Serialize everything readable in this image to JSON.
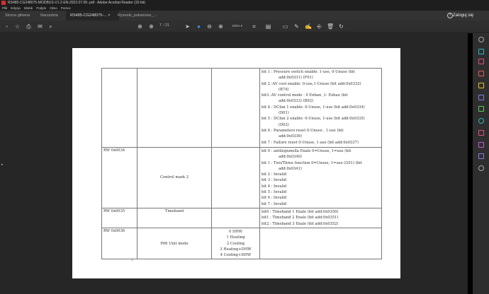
{
  "window": {
    "title": "RS485-CG248075-MODBUS-V1.2-EN-2022.07.05-.pdf - Adobe Acrobat Reader (32-bit)"
  },
  "menu": [
    "Plik",
    "Edycja",
    "Widok",
    "Podpis",
    "Okno",
    "Pomoc"
  ],
  "tabs": [
    "Strona główna",
    "Narzędzia",
    "RS485-CG248075-...",
    "Rysunki_pokazowe_..."
  ],
  "login": "Zaloguj się",
  "toolbar": {
    "page_current": "7",
    "page_total": "/ 21",
    "zoom": "100%"
  },
  "table": {
    "rows": [
      {
        "addr": "",
        "name": "",
        "values": [],
        "bits": [
          [
            "bit 1 : Pressure switch enable: 1-use, 0-Unuse (bit",
            "add:0x0331)  (F01)"
          ],
          [
            "bit 2 :AV cool enable: 0-use,1-Unuse (bit add:0x0332)",
            "(B74)"
          ],
          [
            "bit3  :AV  control  mode :  0  Enhan  ,1-  Exhau  (bit",
            "add:0x0333)  (B92)"
          ],
          [
            "bit 4 : DCfan 1 enable: 0-Unuse, 1-use (bit add:0x0334)",
            "(D01)"
          ],
          [
            "bit 5 : DCfan 2 enable: 0-Unuse, 1-use (bit add:0x0335)",
            "(D02)"
          ],
          [
            "bit  6  :  Parameters  reset  0-Unuse ,  1-use  (bit",
            "add:0x0336)"
          ],
          [
            "bit 7 : Failure reset 0-Unuse, 1-use (bit add:0x0337)"
          ]
        ]
      },
      {
        "addr": "RW 0x0034",
        "name": "Control mark 2",
        "values": [],
        "bits": [
          [
            "bit 0 : antilegionella Enale 0=Unuse, 1=use  (bit",
            "add:0x0340)"
          ],
          [
            "bit 1 : Two/Three function 0=Unuse, 1=use (G01) (bit",
            "add:0x0341)"
          ],
          [
            "bit 2 : Invalid"
          ],
          [
            "bit 3 : Invalid"
          ],
          [
            "bit 4 : Invalid"
          ],
          [
            "bit 5 : Invalid"
          ],
          [
            "bit 6 : Invalid"
          ],
          [
            "bit 7 : Invalid"
          ]
        ]
      },
      {
        "addr": "RW 0x0035",
        "name": "Timeband",
        "values": [],
        "bits": [
          [
            "bit0 : Timeband 1 Enale (bit add:0x0350)"
          ],
          [
            "bit1 : Timeband 2 Enale (bit add:0x0351)"
          ],
          [
            "bit2 : Timeband 3 Enale (bit add:0x0352)"
          ]
        ]
      },
      {
        "addr": "RW 0x0036",
        "name": "P06 Unit mode",
        "values": [
          "0 DHW",
          "1 Heating",
          "2 Cooling",
          "3 Heating+DHW",
          "4 Cooling+DHW"
        ],
        "bits": []
      }
    ]
  },
  "page_footer": "7"
}
